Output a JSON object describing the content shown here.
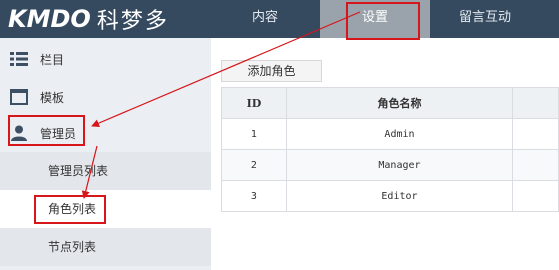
{
  "header": {
    "logo_latin": "KMDO",
    "logo_cn": "科梦多",
    "nav": [
      {
        "label": "内容"
      },
      {
        "label": "设置"
      },
      {
        "label": "留言互动"
      }
    ]
  },
  "sidebar": {
    "items": [
      {
        "label": "栏目",
        "icon": "list-icon"
      },
      {
        "label": "模板",
        "icon": "window-icon"
      },
      {
        "label": "管理员",
        "icon": "user-icon"
      }
    ],
    "sub_items": [
      {
        "label": "管理员列表"
      },
      {
        "label": "角色列表"
      },
      {
        "label": "节点列表"
      }
    ]
  },
  "main": {
    "add_button": "添加角色",
    "table": {
      "headers": [
        "ID",
        "角色名称",
        ""
      ],
      "rows": [
        {
          "id": "1",
          "name": "Admin"
        },
        {
          "id": "2",
          "name": "Manager"
        },
        {
          "id": "3",
          "name": "Editor"
        }
      ]
    }
  },
  "colors": {
    "header_bg": "#35495f",
    "active_nav_bg": "#9aa3ab",
    "sidebar_bg": "#ebeef2",
    "annotation_red": "#d6161a"
  }
}
